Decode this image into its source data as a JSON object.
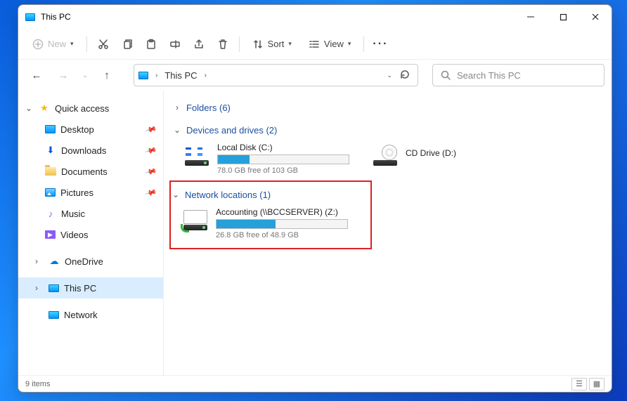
{
  "window": {
    "title": "This PC"
  },
  "toolbar": {
    "new_label": "New",
    "sort_label": "Sort",
    "view_label": "View"
  },
  "address": {
    "crumb": "This PC"
  },
  "search": {
    "placeholder": "Search This PC"
  },
  "sidebar": {
    "quick_access": "Quick access",
    "items": [
      {
        "label": "Desktop"
      },
      {
        "label": "Downloads"
      },
      {
        "label": "Documents"
      },
      {
        "label": "Pictures"
      },
      {
        "label": "Music"
      },
      {
        "label": "Videos"
      }
    ],
    "onedrive": "OneDrive",
    "this_pc": "This PC",
    "network": "Network"
  },
  "sections": {
    "folders": {
      "label": "Folders",
      "count": 6
    },
    "devices": {
      "label": "Devices and drives",
      "count": 2
    },
    "network": {
      "label": "Network locations",
      "count": 1
    }
  },
  "drives": {
    "local": {
      "name": "Local Disk (C:)",
      "free": "78.0 GB free of 103 GB",
      "fill_pct": 24
    },
    "cd": {
      "name": "CD Drive (D:)"
    },
    "net": {
      "name": "Accounting (\\\\BCCSERVER) (Z:)",
      "free": "26.8 GB free of 48.9 GB",
      "fill_pct": 45
    }
  },
  "status": {
    "items": "9 items"
  }
}
